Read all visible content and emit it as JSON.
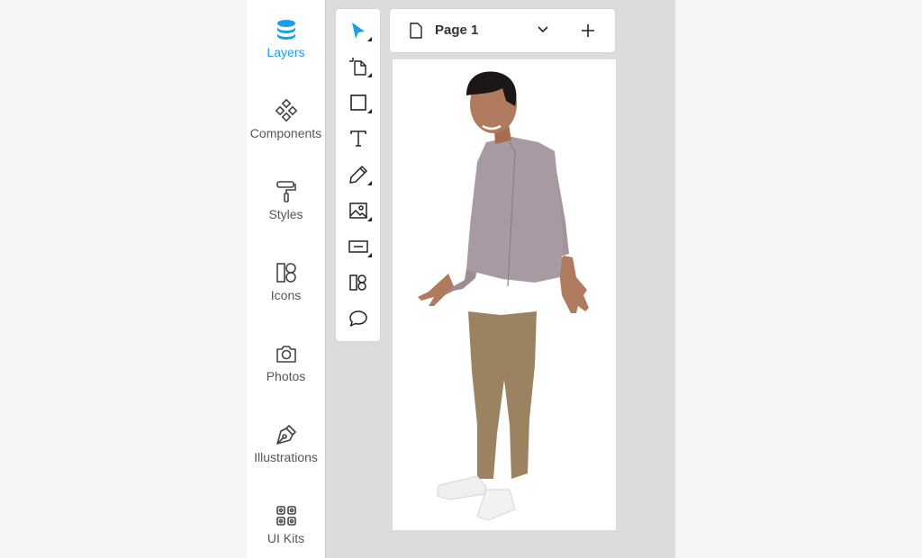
{
  "sidebar": {
    "items": [
      {
        "label": "Layers",
        "icon": "layers-icon",
        "active": true
      },
      {
        "label": "Components",
        "icon": "components-icon"
      },
      {
        "label": "Styles",
        "icon": "paint-roller-icon"
      },
      {
        "label": "Icons",
        "icon": "icons-shapes-icon"
      },
      {
        "label": "Photos",
        "icon": "camera-icon"
      },
      {
        "label": "Illustrations",
        "icon": "pen-nib-icon"
      },
      {
        "label": "UI Kits",
        "icon": "grid-kit-icon"
      }
    ]
  },
  "toolbar": {
    "tools": [
      "select-arrow-icon",
      "frame-icon",
      "rectangle-icon",
      "text-icon",
      "pencil-icon",
      "image-icon",
      "button-shape-icon",
      "icons-shapes-icon",
      "comment-icon"
    ]
  },
  "page_selector": {
    "page_name": "Page 1",
    "chevron_icon": "chevron-down-icon",
    "add_icon": "plus-icon"
  },
  "colors": {
    "accent": "#1a9ee8",
    "panel_bg": "#ffffff",
    "workspace_bg": "#dcdcdc",
    "outer_bg": "#f5f5f5"
  }
}
